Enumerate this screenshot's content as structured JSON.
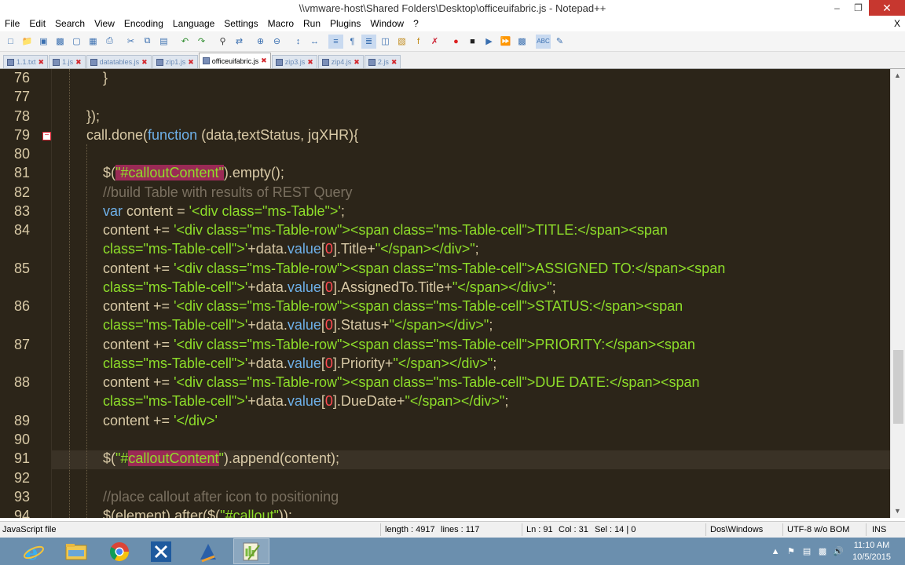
{
  "window": {
    "title": "\\\\vmware-host\\Shared Folders\\Desktop\\officeuifabric.js - Notepad++",
    "min": "–",
    "restore": "❐",
    "close": "✕"
  },
  "menu": [
    "File",
    "Edit",
    "Search",
    "View",
    "Encoding",
    "Language",
    "Settings",
    "Macro",
    "Run",
    "Plugins",
    "Window",
    "?"
  ],
  "menu_close": "X",
  "toolbar_icons": [
    "new-icon",
    "open-icon",
    "save-icon",
    "save-all-icon",
    "close-icon",
    "close-all-icon",
    "print-icon",
    "cut-icon",
    "copy-icon",
    "paste-icon",
    "undo-icon",
    "redo-icon",
    "find-icon",
    "replace-icon",
    "zoom-in-icon",
    "zoom-out-icon",
    "sync-v-icon",
    "sync-h-icon",
    "wrap-icon",
    "all-chars-icon",
    "indent-guide-icon",
    "udl-icon",
    "doc-map-icon",
    "function-list-icon",
    "folder-workspace-icon",
    "monitoring-icon",
    "record-icon",
    "stop-icon",
    "play-icon",
    "play-multi-icon",
    "save-macro-icon",
    "spellcheck-icon",
    "spellcheck-settings-icon"
  ],
  "tabs": [
    {
      "label": "1.1.txt",
      "active": false
    },
    {
      "label": "1.js",
      "active": false
    },
    {
      "label": "datatables.js",
      "active": false
    },
    {
      "label": "zip1.js",
      "active": false
    },
    {
      "label": "officeuifabric.js",
      "active": true
    },
    {
      "label": "zip3.js",
      "active": false
    },
    {
      "label": "zip4.js",
      "active": false
    },
    {
      "label": "2.js",
      "active": false
    }
  ],
  "tab_close": "✖",
  "editor": {
    "line_numbers": [
      "76",
      "77",
      "78",
      "79",
      "80",
      "81",
      "82",
      "83",
      "84",
      "",
      "85",
      "",
      "86",
      "",
      "87",
      "",
      "88",
      "",
      "89",
      "90",
      "91",
      "92",
      "93",
      "94"
    ],
    "current_line_index": 20,
    "fold_marker": "−"
  },
  "status": {
    "file_type": "JavaScript file",
    "length": "length : 4917",
    "lines": "lines : 117",
    "ln": "Ln : 91",
    "col": "Col : 31",
    "sel": "Sel : 14 | 0",
    "eol": "Dos\\Windows",
    "encoding": "UTF-8 w/o BOM",
    "mode": "INS"
  },
  "taskbar": {
    "apps": [
      "ie-icon",
      "file-explorer-icon",
      "chrome-icon",
      "tools-icon",
      "editor-icon",
      "notepadpp-icon"
    ],
    "time": "11:10 AM",
    "date": "10/5/2015"
  }
}
